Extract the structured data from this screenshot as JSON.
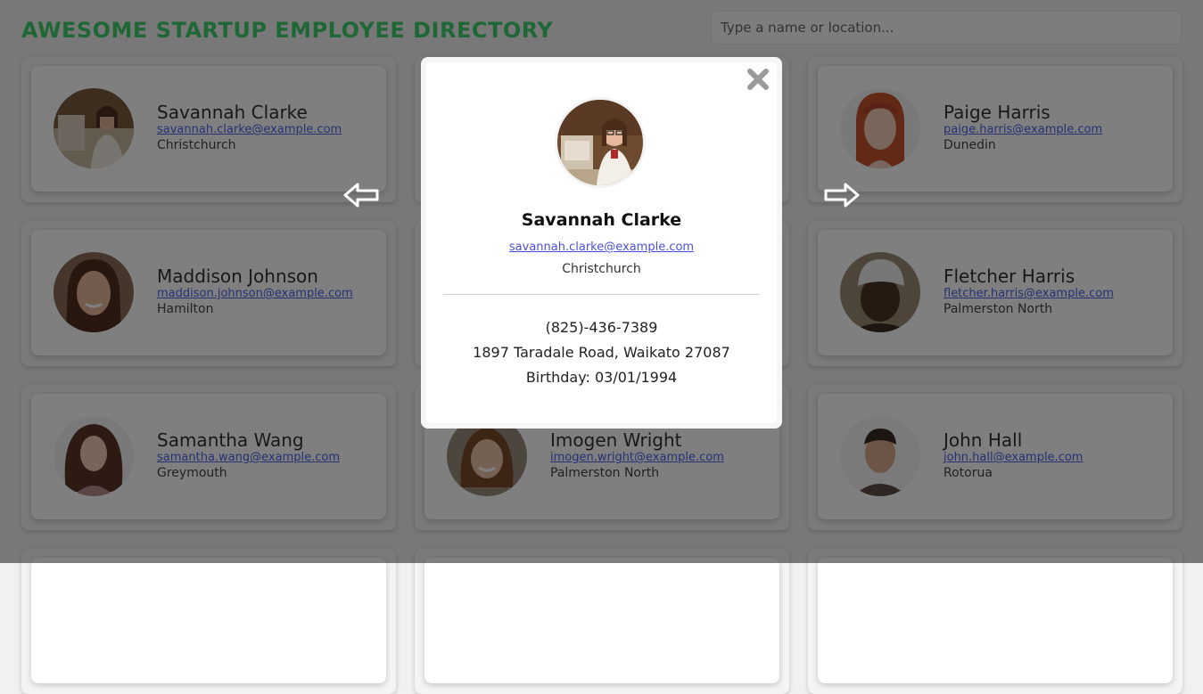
{
  "header": {
    "title": "AWESOME STARTUP EMPLOYEE DIRECTORY",
    "search_placeholder": "Type a name or location..."
  },
  "employees": [
    {
      "name": "Savannah Clarke",
      "email": "savannah.clarke@example.com",
      "city": "Christchurch"
    },
    {
      "name": "",
      "email": "",
      "city": ""
    },
    {
      "name": "Paige Harris",
      "email": "paige.harris@example.com",
      "city": "Dunedin"
    },
    {
      "name": "Maddison Johnson",
      "email": "maddison.johnson@example.com",
      "city": "Hamilton"
    },
    {
      "name": "",
      "email": "",
      "city": ""
    },
    {
      "name": "Fletcher Harris",
      "email": "fletcher.harris@example.com",
      "city": "Palmerston North"
    },
    {
      "name": "Samantha Wang",
      "email": "samantha.wang@example.com",
      "city": "Greymouth"
    },
    {
      "name": "Imogen Wright",
      "email": "imogen.wright@example.com",
      "city": "Palmerston North"
    },
    {
      "name": "John Hall",
      "email": "john.hall@example.com",
      "city": "Rotorua"
    }
  ],
  "modal": {
    "name": "Savannah Clarke",
    "email": "savannah.clarke@example.com",
    "city": "Christchurch",
    "phone": "(825)-436-7389",
    "address": "1897 Taradale Road, Waikato 27087",
    "birthday": "Birthday: 03/01/1994"
  },
  "colors": {
    "accent": "#3ed06b",
    "link": "#4a63e6",
    "overlay": "rgba(0,0,0,0.5)"
  },
  "icons": {
    "close": "close-icon",
    "prev": "arrow-left-icon",
    "next": "arrow-right-icon"
  }
}
